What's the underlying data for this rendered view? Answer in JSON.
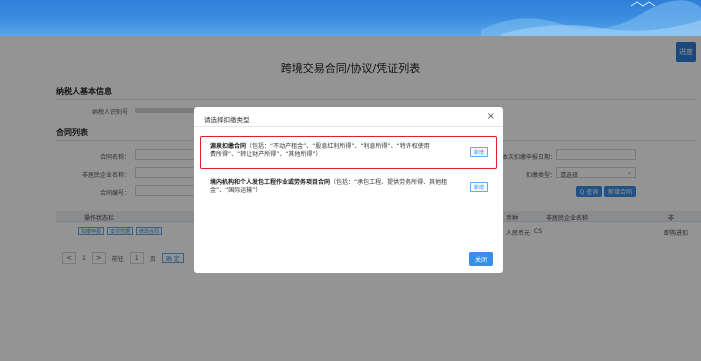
{
  "header": {
    "side_tab_label": "进度"
  },
  "page": {
    "title": "跨境交易合同/协议/凭证列表"
  },
  "taxpayer_section": {
    "title": "纳税人基本信息",
    "tax_id_label": "纳税人识别号"
  },
  "contract_section": {
    "title": "合同列表",
    "fields": {
      "contract_name_label": "合同名称：",
      "foreign_company_label": "非居民企业名称：",
      "contract_no_label": "合同编号：",
      "report_date_label": "本次扣缴申报日期：",
      "withholding_type_label": "扣缴类型：",
      "withholding_type_value": "请选择"
    },
    "buttons": {
      "query": "Q 查询",
      "add_contract": "新增合同"
    }
  },
  "table": {
    "headers": [
      "操作状态栏",
      "币种",
      "非居民企业名称",
      "非"
    ],
    "row": {
      "actions": [
        "扣缴申报",
        "支付凭据",
        "修改合同"
      ],
      "currency": "人民币元",
      "company": "CS",
      "last": "即购进扣"
    }
  },
  "pagination": {
    "prev": "<",
    "current_page_num": "1",
    "next": ">",
    "goto_label": "前往",
    "goto_value": "1",
    "page_unit": "页",
    "confirm": "确 定"
  },
  "modal": {
    "title": "请选择扣缴类型",
    "option1": {
      "name": "源泉扣缴合同",
      "detail_line1": "（包括：“不动产租金”、“股息红利所得”、“利息所得”、“特许权使用",
      "detail_line2": "费所得”、“转让财产所得”、“其他所得”）",
      "button": "新增"
    },
    "option2": {
      "name": "境内机构和个人发包工程作业或劳务项目合同",
      "detail_line1": "（包括：“承包工程、提供劳务所得、其他租",
      "detail_line2": "金”、“国际运输”）",
      "button": "新增"
    },
    "close_button": "关闭"
  }
}
